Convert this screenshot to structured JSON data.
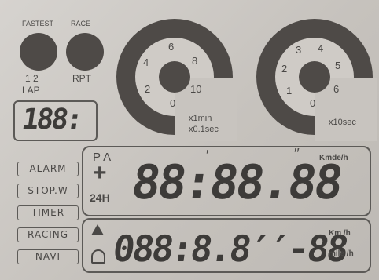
{
  "top_left": {
    "fastest": "FASTEST",
    "race": "RACE",
    "lap_nums": "1  2",
    "rpt": "RPT",
    "lap": "LAP",
    "lap_value": "188:"
  },
  "dial_left": {
    "numbers": [
      "6",
      "8",
      "4",
      "2",
      "10",
      "0"
    ],
    "unit1": "x1min",
    "unit2": "x0.1sec"
  },
  "dial_right": {
    "numbers": [
      "3",
      "4",
      "2",
      "5",
      "1",
      "6",
      "0"
    ],
    "unit": "x10sec"
  },
  "main_display": {
    "pa": "P A",
    "plus": "+",
    "h24": "24H",
    "digits": "88:88.88",
    "prime": "′",
    "double_prime": "′′",
    "unit": "Kmde/h"
  },
  "bottom_display": {
    "digits": "088:8.8′′-88",
    "unit1": "Km /h",
    "unit2": "mile /h"
  },
  "modes": [
    "ALARM",
    "STOP.W",
    "TIMER",
    "RACING",
    "NAVI"
  ]
}
